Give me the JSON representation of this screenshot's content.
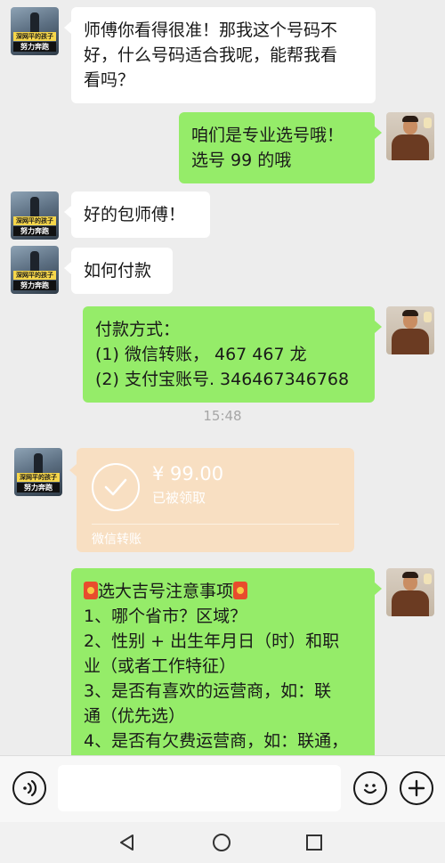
{
  "messages": {
    "m1": {
      "lines": [
        "师傅你看得很准！那我这个号码不",
        "好，什么号码适合我呢，能帮我看",
        "看吗？"
      ]
    },
    "m2": {
      "lines": [
        "咱们是专业选号哦！",
        "选号 99 的哦"
      ]
    },
    "m3": {
      "lines": [
        "好的包师傅！"
      ]
    },
    "m4": {
      "lines": [
        "如何付款"
      ]
    },
    "m5": {
      "lines": [
        "付款方式：",
        "(1) 微信转账，        467  467 龙",
        "(2) 支付宝账号. 346467346768"
      ]
    },
    "m7": {
      "title": "选大吉号注意事项",
      "lines": [
        "1、哪个省市？区域？",
        "2、性别 + 出生年月日（时）和职",
        "业（或者工作特征）",
        "3、是否有喜欢的运营商，如：联",
        "通（优先选）",
        "4、是否有欠费运营商，如：联通，"
      ]
    }
  },
  "timestamp": "15:48",
  "transfer": {
    "amount": "¥ 99.00",
    "status": "已被领取",
    "label": "微信转账"
  },
  "avatars": {
    "left_caption_top": "深网平的孩子",
    "left_caption_bottom": "努力奔跑"
  },
  "input": {
    "placeholder": ""
  },
  "icons": {
    "voice": "voice-icon",
    "emoji": "emoji-icon",
    "plus": "plus-icon",
    "back": "back-icon",
    "home": "home-icon",
    "recent": "recent-apps-icon"
  },
  "colors": {
    "chat_bg": "#ededed",
    "bubble_sent": "#95ec69",
    "bubble_received": "#ffffff",
    "transfer_bg": "#f8dfc2"
  }
}
